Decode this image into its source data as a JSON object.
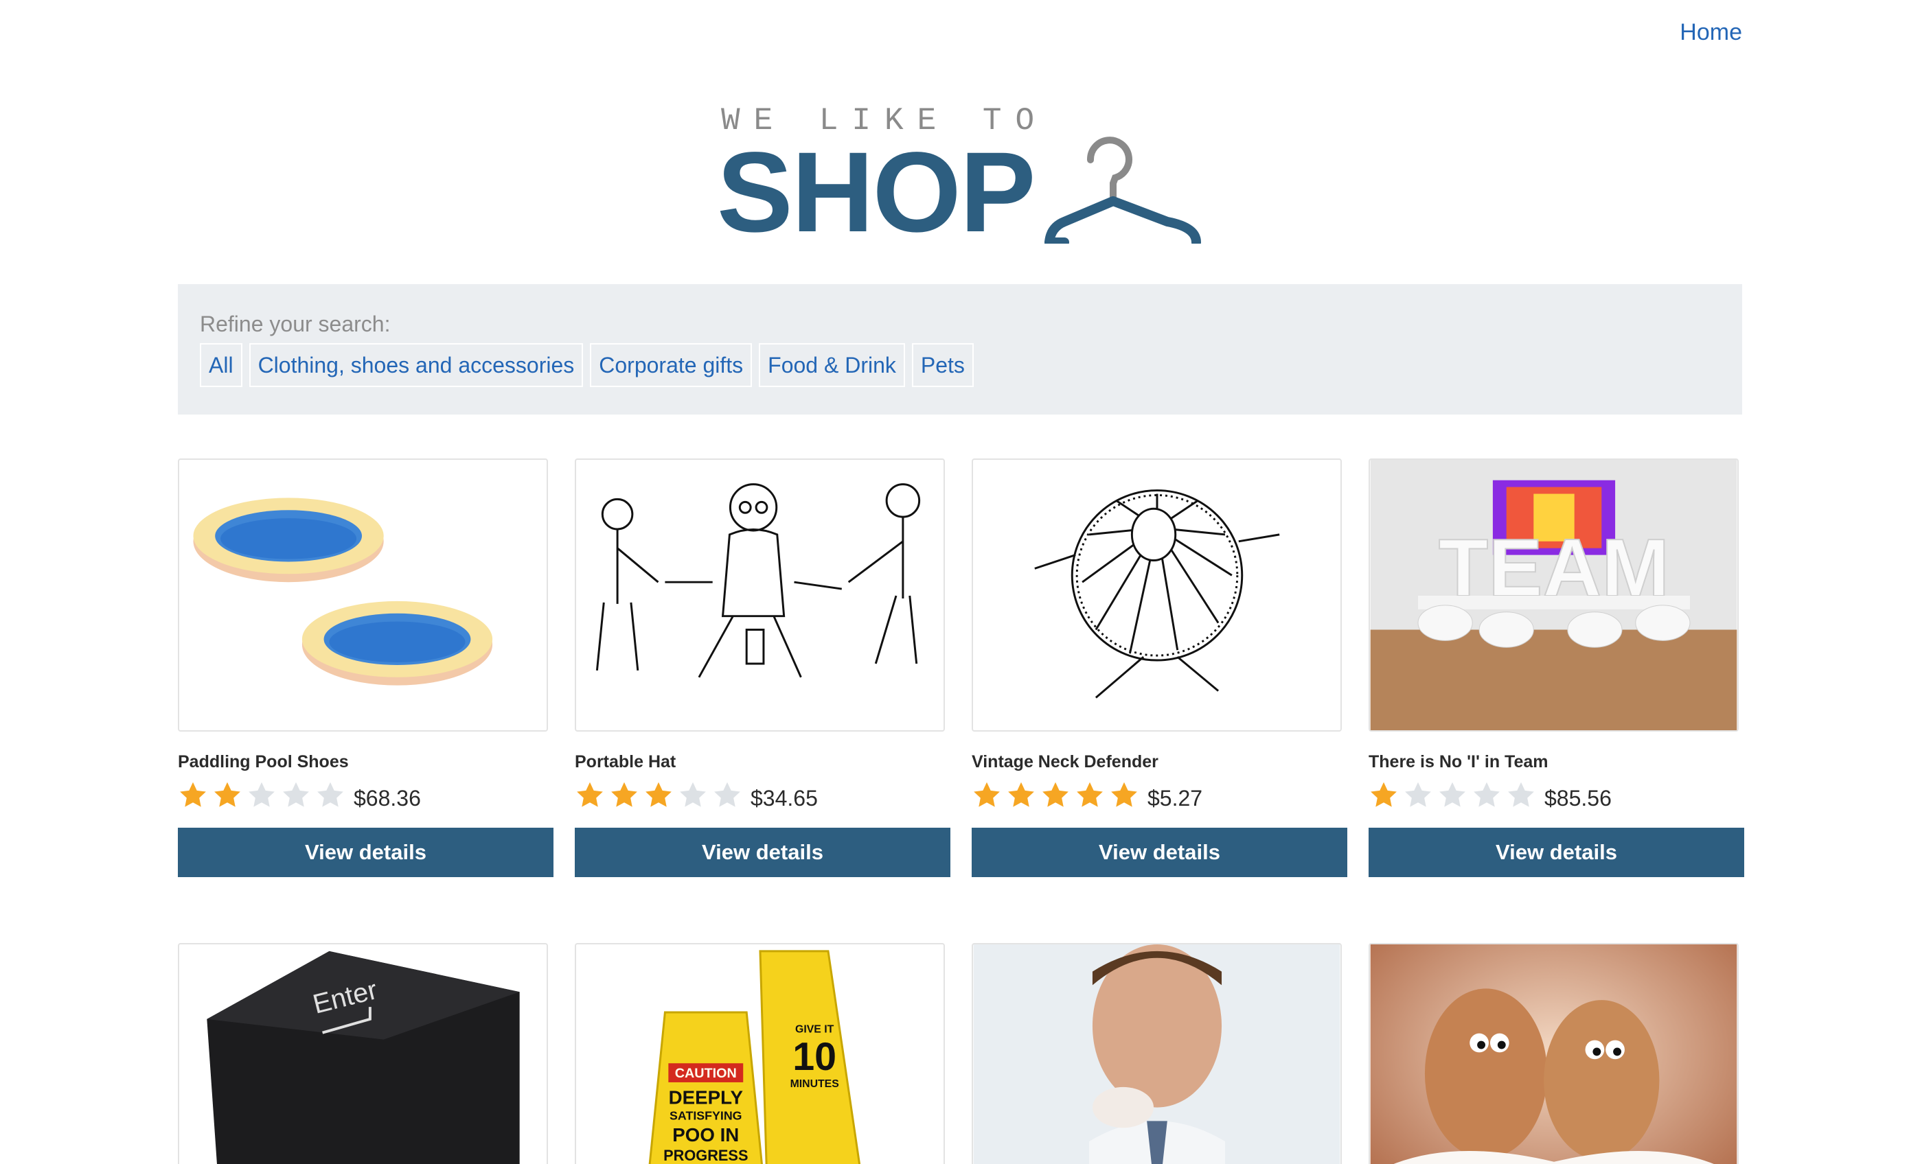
{
  "nav": {
    "home_label": "Home"
  },
  "logo": {
    "tagline": "WE LIKE TO",
    "word": "SHOP"
  },
  "filter": {
    "label": "Refine your search:",
    "options": [
      "All",
      "Clothing, shoes and accessories",
      "Corporate gifts",
      "Food & Drink",
      "Pets"
    ]
  },
  "colors": {
    "brand": "#2d5e80",
    "link": "#2366b6",
    "star_filled": "#f6a623",
    "star_empty": "#dde1e5",
    "filter_bg": "#ebeef1"
  },
  "products": [
    {
      "name": "Paddling Pool Shoes",
      "rating": 2,
      "max_rating": 5,
      "price": "$68.36",
      "button": "View details",
      "image_icon": "paddling-pool-image"
    },
    {
      "name": "Portable Hat",
      "rating": 3,
      "max_rating": 5,
      "price": "$34.65",
      "button": "View details",
      "image_icon": "cartoon-sketch-image"
    },
    {
      "name": "Vintage Neck Defender",
      "rating": 5,
      "max_rating": 5,
      "price": "$5.27",
      "button": "View details",
      "image_icon": "ruff-collar-sketch-image"
    },
    {
      "name": "There is No 'I' in Team",
      "rating": 1,
      "max_rating": 5,
      "price": "$85.56",
      "button": "View details",
      "image_icon": "team-letters-image"
    }
  ],
  "products_row2": [
    {
      "image_icon": "enter-key-pillow-image",
      "key_label": "Enter"
    },
    {
      "image_icon": "caution-signs-image",
      "sign_text": [
        "CAUTION",
        "DEEPLY",
        "SATISFYING",
        "POO IN",
        "PROGRESS"
      ],
      "sign2_text": [
        "GIVE IT",
        "10",
        "MINUTES"
      ]
    },
    {
      "image_icon": "man-eating-image"
    },
    {
      "image_icon": "eggs-image"
    }
  ]
}
